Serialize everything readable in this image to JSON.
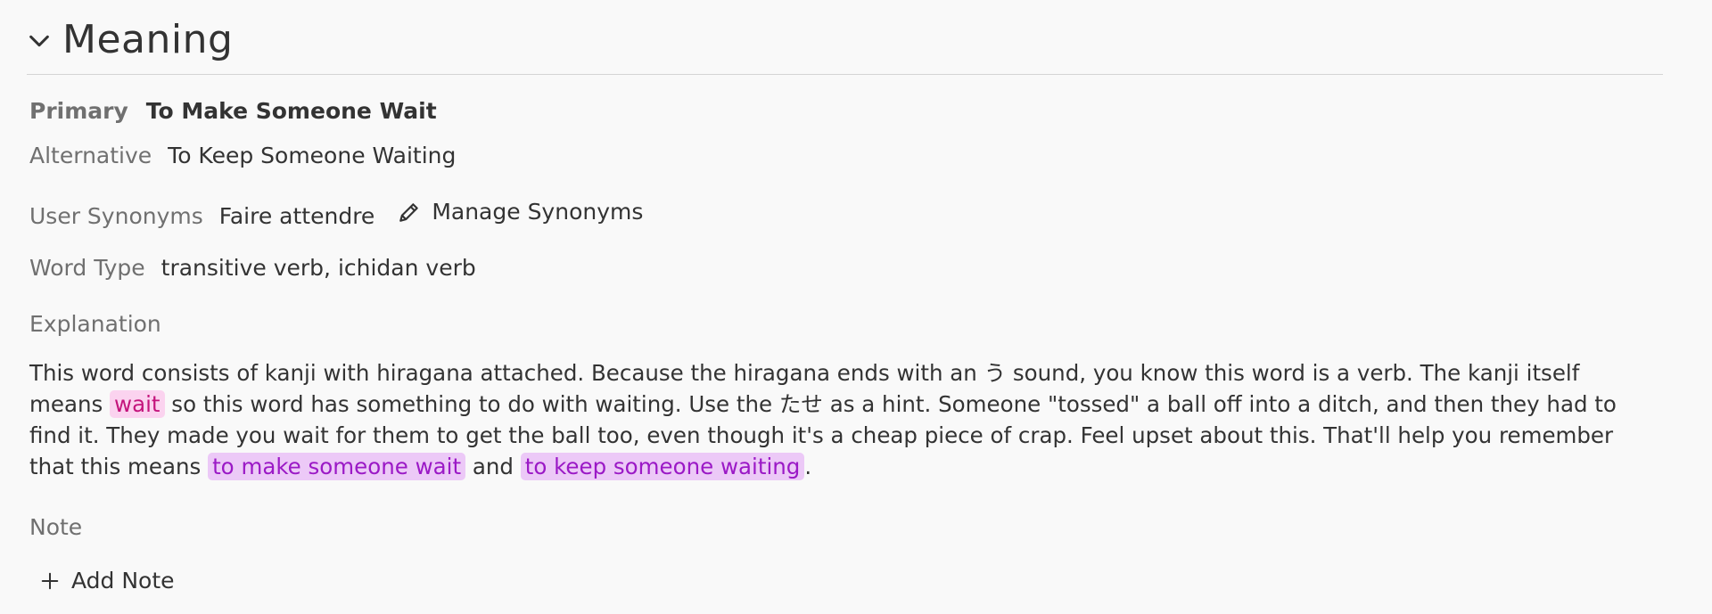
{
  "section": {
    "title": "Meaning"
  },
  "primary": {
    "label": "Primary",
    "value": "To Make Someone Wait"
  },
  "alternative": {
    "label": "Alternative",
    "value": "To Keep Someone Waiting"
  },
  "user_synonyms": {
    "label": "User Synonyms",
    "value": "Faire attendre",
    "manage_label": "Manage Synonyms"
  },
  "word_type": {
    "label": "Word Type",
    "value": "transitive verb, ichidan verb"
  },
  "explanation": {
    "label": "Explanation",
    "parts": {
      "p1": "This word consists of kanji with hiragana attached. Because the hiragana ends with an う sound, you know this word is a verb. The kanji itself means ",
      "hl1": "wait",
      "p2": " so this word has something to do with waiting. Use the たせ as a hint. Someone \"tossed\" a ball off into a ditch, and then they had to find it. They made you wait for them to get the ball too, even though it's a cheap piece of crap. Feel upset about this. That'll help you remember that this means ",
      "hl2": "to make someone wait",
      "p3": " and ",
      "hl3": "to keep someone waiting",
      "p4": "."
    }
  },
  "note": {
    "label": "Note",
    "add_label": "Add Note"
  },
  "icons": {
    "collapse": "chevron-down-icon",
    "edit": "pencil-icon",
    "add": "plus-icon"
  },
  "colors": {
    "kanji_highlight_bg": "#fbd3ef",
    "kanji_highlight_text": "#c4157c",
    "vocab_highlight_bg": "#ecc9f7",
    "vocab_highlight_text": "#9b19c6"
  }
}
